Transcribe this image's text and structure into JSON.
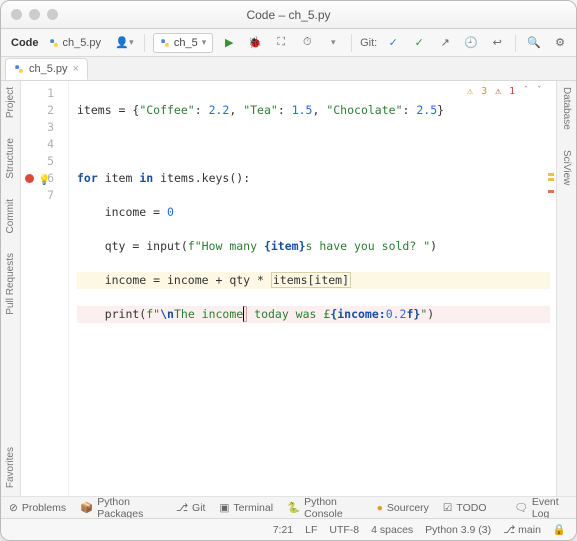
{
  "window": {
    "title": "Code – ch_5.py"
  },
  "toolbar": {
    "project": "Code",
    "crumb_file": "ch_5.py",
    "run_config": "ch_5",
    "git_label": "Git:"
  },
  "tabs": {
    "file": "ch_5.py"
  },
  "sidebar_left": {
    "project": "Project",
    "structure": "Structure",
    "commit": "Commit",
    "pull_requests": "Pull Requests",
    "favorites": "Favorites"
  },
  "sidebar_right": {
    "database": "Database",
    "sciview": "SciView"
  },
  "inspection": {
    "warn_count": "3",
    "err_count": "1",
    "up": "^",
    "down": "v"
  },
  "code": {
    "lines": [
      "1",
      "2",
      "3",
      "4",
      "5",
      "6",
      "7"
    ],
    "l1_a": "items = {",
    "l1_s1": "\"Coffee\"",
    "l1_b": ": ",
    "l1_n1": "2.2",
    "l1_c": ", ",
    "l1_s2": "\"Tea\"",
    "l1_d": ": ",
    "l1_n2": "1.5",
    "l1_e": ", ",
    "l1_s3": "\"Chocolate\"",
    "l1_f": ": ",
    "l1_n3": "2.5",
    "l1_g": "}",
    "l3_a": "for",
    "l3_b": " item ",
    "l3_c": "in",
    "l3_d": " items.keys():",
    "l4_a": "    income = ",
    "l4_n": "0",
    "l5_a": "    qty = input(",
    "l5_s": "f\"How many ",
    "l5_v": "{item}",
    "l5_s2": "s have you sold? \"",
    "l5_b": ")",
    "l6_a": "    income = income + qty * ",
    "l6_box": "items[item]",
    "l7_a": "    print(",
    "l7_s1": "f\"",
    "l7_esc": "\\n",
    "l7_s2": "The income",
    "l7_caret": "",
    "l7_s3": " today was £",
    "l7_v": "{income:",
    "l7_n": "0.2",
    "l7_v2": "f}",
    "l7_s4": "\"",
    "l7_b": ")"
  },
  "bottom": {
    "problems": "Problems",
    "packages": "Python Packages",
    "git": "Git",
    "terminal": "Terminal",
    "console": "Python Console",
    "sourcery": "Sourcery",
    "todo": "TODO",
    "event_log": "Event Log"
  },
  "status": {
    "pos": "7:21",
    "lf": "LF",
    "enc": "UTF-8",
    "indent": "4 spaces",
    "python": "Python 3.9 (3)",
    "branch": "main"
  }
}
